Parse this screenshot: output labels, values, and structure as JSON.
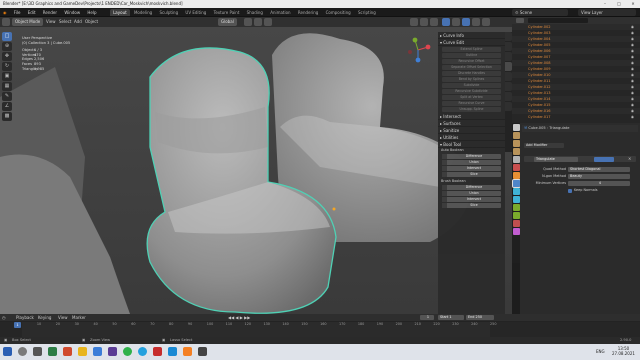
{
  "window": {
    "title": "Blender* [E:\\3D Graphics and GameDev\\Projects\\1 ENDED\\Car_Moskvich\\moskvich.blend]"
  },
  "menu": [
    "Blender",
    "File",
    "Edit",
    "Render",
    "Window",
    "Help"
  ],
  "workspaces": [
    "Layout",
    "Modeling",
    "Sculpting",
    "UV Editing",
    "Texture Paint",
    "Shading",
    "Animation",
    "Rendering",
    "Compositing",
    "Scripting"
  ],
  "active_workspace": "Layout",
  "scene": {
    "label": "Scene",
    "view_layer": "View Layer"
  },
  "viewport_header": {
    "mode": "Object Mode",
    "view": "View",
    "select": "Select",
    "add": "Add",
    "object": "Object",
    "transform": "Global",
    "options": "Options"
  },
  "overlay": {
    "view": "User Perspective",
    "collection": "(0) Collection 3 | Cube.005",
    "stats": [
      {
        "k": "Objects",
        "v": "1 / 3"
      },
      {
        "k": "Vertices",
        "v": "470"
      },
      {
        "k": "Edges",
        "v": "2,506"
      },
      {
        "k": "Faces",
        "v": "893"
      },
      {
        "k": "Triangles",
        "v": "1,985"
      }
    ]
  },
  "npanel": {
    "curve_info": "Curve Info",
    "curve_edit": "Curve Edit",
    "curve_edit_buttons": [
      "Extend Spline",
      "Outline",
      "Recursive Offset",
      "Separate Offset Selection",
      "Discrete Handles",
      "Bend by Splines",
      "Subdivide",
      "Recursive Subdivide",
      "Split at Vertex",
      "Recursive Curve",
      "Unsupp. Spline"
    ],
    "sections": [
      "Intersect",
      "Surfaces",
      "Sanitize",
      "Utilities",
      "Bool Tool"
    ],
    "auto_boolean": "Auto Boolean",
    "brush_boolean": "Brush Boolean",
    "bool_ops": [
      "Difference",
      "Union",
      "Intersect",
      "Slice"
    ]
  },
  "outliner": {
    "items": [
      "Cylinder.002",
      "Cylinder.003",
      "Cylinder.004",
      "Cylinder.005",
      "Cylinder.006",
      "Cylinder.007",
      "Cylinder.008",
      "Cylinder.009",
      "Cylinder.010",
      "Cylinder.011",
      "Cylinder.012",
      "Cylinder.013",
      "Cylinder.014",
      "Cylinder.015",
      "Cylinder.016",
      "Cylinder.017"
    ]
  },
  "properties": {
    "object": "Cube.005",
    "modifier_target": "Triangulate",
    "add_modifier": "Add Modifier",
    "modifier_name": "Triangulate",
    "quad_method_label": "Quad Method",
    "quad_method": "Shortest Diagonal",
    "ngon_method_label": "N-gon Method",
    "ngon_method": "Beauty",
    "min_vertices_label": "Minimum Vertices",
    "min_vertices": "4",
    "keep_normals": "Keep Normals"
  },
  "timeline": {
    "menus": [
      "Playback",
      "Keying",
      "View",
      "Marker"
    ],
    "current_frame": "1",
    "start_label": "Start",
    "start": "1",
    "end_label": "End",
    "end": "250",
    "ticks": [
      "0",
      "10",
      "20",
      "30",
      "40",
      "50",
      "60",
      "70",
      "80",
      "90",
      "100",
      "110",
      "120",
      "130",
      "140",
      "150",
      "160",
      "170",
      "180",
      "190",
      "200",
      "210",
      "220",
      "230",
      "240",
      "250"
    ]
  },
  "status": {
    "select": "Box Select",
    "zoom": "Zoom View",
    "lasso": "Lasso Select",
    "version": "2.90.0"
  },
  "taskbar": {
    "lang": "ENG",
    "time": "13:50",
    "date": "27.08.2021"
  }
}
